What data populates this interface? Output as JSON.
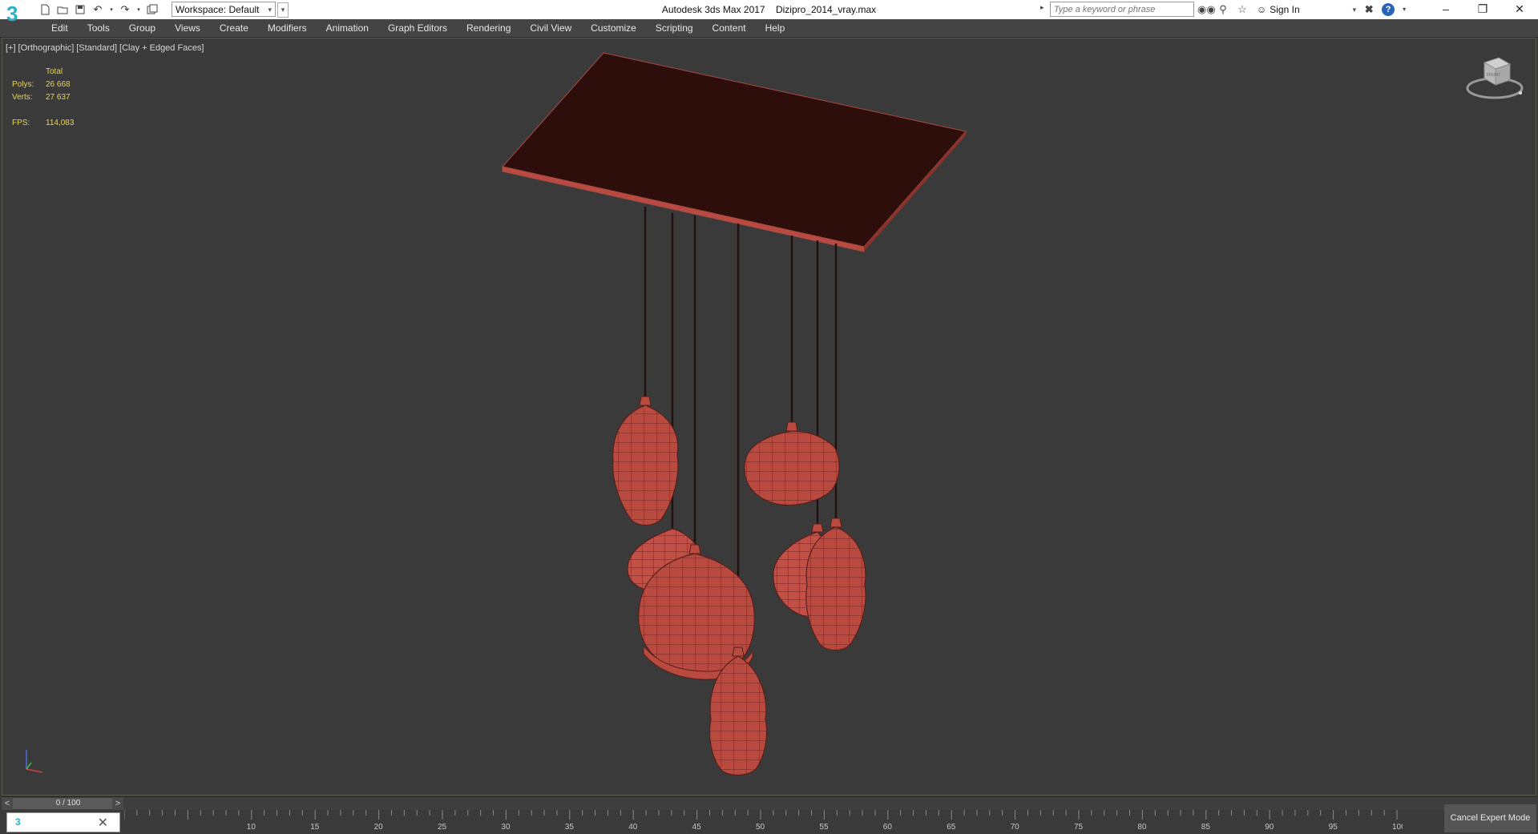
{
  "titlebar": {
    "app_logo": "3",
    "workspace_label": "Workspace: Default",
    "app_name": "Autodesk 3ds Max 2017",
    "file_name": "Dizipro_2014_vray.max",
    "search_placeholder": "Type a keyword or phrase",
    "sign_in": "Sign In"
  },
  "menu": [
    "Edit",
    "Tools",
    "Group",
    "Views",
    "Create",
    "Modifiers",
    "Animation",
    "Graph Editors",
    "Rendering",
    "Civil View",
    "Customize",
    "Scripting",
    "Content",
    "Help"
  ],
  "viewport": {
    "labels": [
      "[+]",
      "[Orthographic]",
      "[Standard]",
      "[Clay + Edged Faces]"
    ],
    "stats": {
      "header": "Total",
      "polys_label": "Polys:",
      "polys_value": "26 668",
      "verts_label": "Verts:",
      "verts_value": "27 637",
      "fps_label": "FPS:",
      "fps_value": "114,083"
    },
    "viewcube_face": "FRONT",
    "object_color": "#b84a40",
    "canopy_color": "#2e0e0b"
  },
  "timeline": {
    "frame_readout": "0 / 100",
    "prev": "<",
    "next": ">",
    "ticks": [
      "10",
      "15",
      "20",
      "25",
      "30",
      "35",
      "40",
      "45",
      "50",
      "55",
      "60",
      "65",
      "70",
      "75",
      "80",
      "85",
      "90",
      "95",
      "100"
    ]
  },
  "cancel_expert_mode": "Cancel Expert Mode"
}
